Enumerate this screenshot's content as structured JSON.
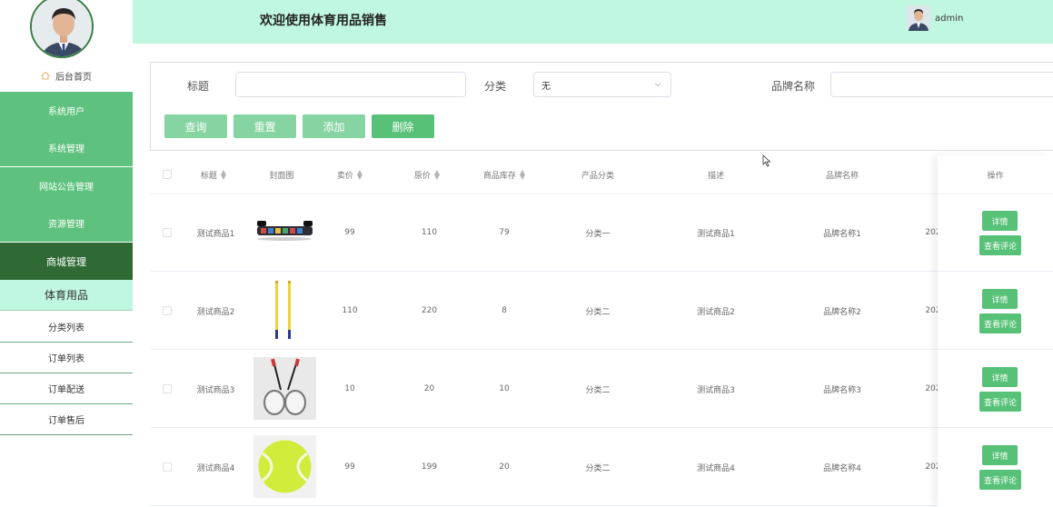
{
  "sidebar": {
    "home_label": "后台首页",
    "menu": [
      {
        "label": "系统用户"
      },
      {
        "label": "系统管理"
      },
      {
        "label": "网站公告管理"
      },
      {
        "label": "资源管理"
      },
      {
        "label": "商城管理"
      }
    ],
    "submenu_head": "体育用品",
    "submenu": [
      {
        "label": "分类列表"
      },
      {
        "label": "订单列表"
      },
      {
        "label": "订单配送"
      },
      {
        "label": "订单售后"
      }
    ]
  },
  "header": {
    "title": "欢迎使用体育用品销售",
    "username": "admin"
  },
  "search": {
    "title_label": "标题",
    "category_label": "分类",
    "category_value": "无",
    "brand_label": "品牌名称",
    "buttons": {
      "query": "查询",
      "reset": "重置",
      "add": "添加",
      "delete": "删除"
    }
  },
  "table": {
    "headers": {
      "title": "标题",
      "cover": "封面图",
      "price": "卖价",
      "orig_price": "原价",
      "stock": "商品库存",
      "category": "产品分类",
      "desc": "描述",
      "brand": "品牌名称",
      "ops": "操作"
    },
    "rows": [
      {
        "title": "测试商品1",
        "image": "pushup-board",
        "price": "99",
        "orig_price": "110",
        "stock": "79",
        "category": "分类一",
        "desc": "测试商品1",
        "brand": "品牌名称1",
        "date": "202"
      },
      {
        "title": "测试商品2",
        "image": "sticks",
        "price": "110",
        "orig_price": "220",
        "stock": "8",
        "category": "分类二",
        "desc": "测试商品2",
        "brand": "品牌名称2",
        "date": "202"
      },
      {
        "title": "测试商品3",
        "image": "badminton-rackets",
        "price": "10",
        "orig_price": "20",
        "stock": "10",
        "category": "分类二",
        "desc": "测试商品3",
        "brand": "品牌名称3",
        "date": "202"
      },
      {
        "title": "测试商品4",
        "image": "tennis-ball",
        "price": "99",
        "orig_price": "199",
        "stock": "20",
        "category": "分类二",
        "desc": "测试商品4",
        "brand": "品牌名称4",
        "date": "202"
      }
    ],
    "detail_label": "详情",
    "comment_label": "查看评论"
  }
}
